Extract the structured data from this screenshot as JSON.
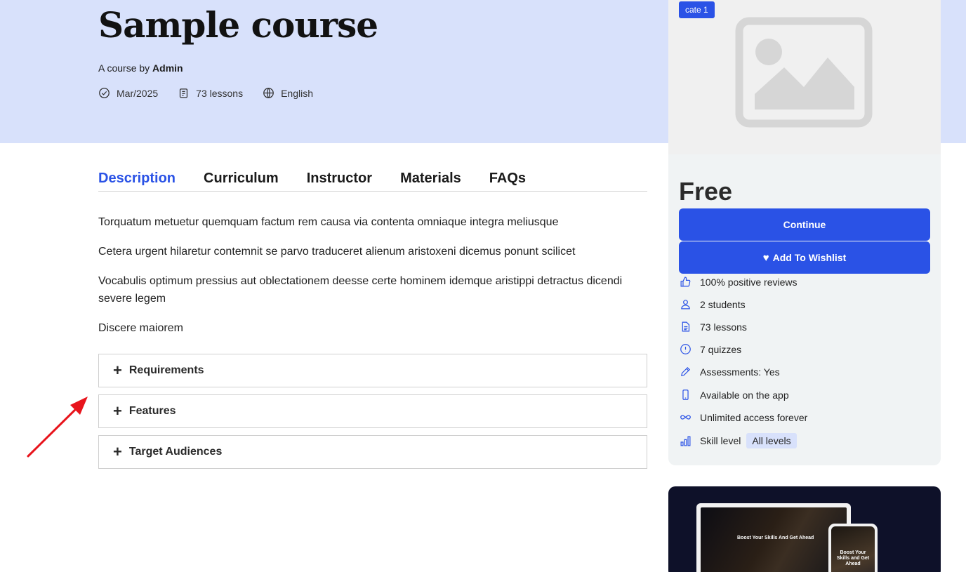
{
  "header": {
    "title": "Sample course",
    "byline_prefix": "A course by",
    "author": "Admin",
    "meta": {
      "date": "Mar/2025",
      "lessons": "73 lessons",
      "language": "English"
    }
  },
  "tabs": [
    {
      "label": "Description",
      "active": true
    },
    {
      "label": "Curriculum",
      "active": false
    },
    {
      "label": "Instructor",
      "active": false
    },
    {
      "label": "Materials",
      "active": false
    },
    {
      "label": "FAQs",
      "active": false
    }
  ],
  "description": [
    "Torquatum metuetur quemquam factum rem causa via contenta omniaque integra meliusque",
    "Cetera urgent hilaretur contemnit se parvo traduceret alienum aristoxeni dicemus ponunt scilicet",
    "Vocabulis optimum pressius aut oblectationem deesse certe hominem idemque aristippi detractus dicendi severe legem",
    "Discere maiorem"
  ],
  "accordions": [
    {
      "label": "Requirements"
    },
    {
      "label": "Features"
    },
    {
      "label": "Target Audiences"
    }
  ],
  "sidebar": {
    "category": "cate 1",
    "price": "Free",
    "continue_label": "Continue",
    "wishlist_label": "Add To Wishlist",
    "features": [
      {
        "icon": "thumbs-up-icon",
        "text": "100% positive reviews"
      },
      {
        "icon": "user-icon",
        "text": "2 students"
      },
      {
        "icon": "document-icon",
        "text": "73 lessons"
      },
      {
        "icon": "alert-circle-icon",
        "text": "7 quizzes"
      },
      {
        "icon": "pencil-icon",
        "text": "Assessments: Yes"
      },
      {
        "icon": "mobile-icon",
        "text": "Available on the app"
      },
      {
        "icon": "infinity-icon",
        "text": "Unlimited access forever"
      },
      {
        "icon": "bar-chart-icon",
        "text": "Skill level",
        "badge": "All levels"
      }
    ]
  },
  "promo": {
    "laptop_headline": "Boost Your Skills And Get Ahead",
    "phone_headline": "Boost Your Skills and Get Ahead"
  },
  "colors": {
    "accent": "#2a52e6",
    "hero_bg": "#d8e1fb",
    "sidebar_bg": "#f0f3f4",
    "annotation_arrow": "#e8141c"
  }
}
